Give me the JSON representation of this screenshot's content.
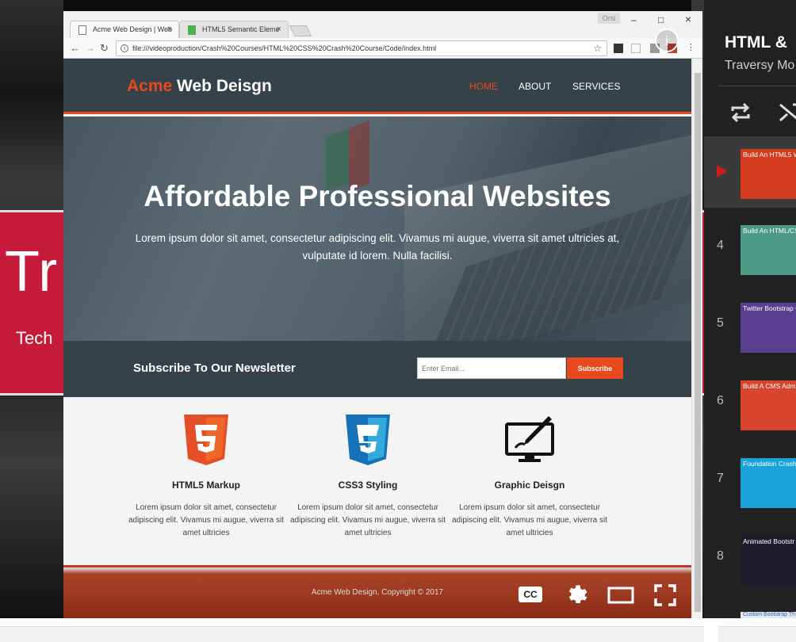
{
  "browser": {
    "tabs": [
      {
        "label": "Acme Web Design | Web",
        "close": "×"
      },
      {
        "label": "HTML5 Semantic Eleme",
        "close": "×"
      }
    ],
    "window_controls": {
      "minimize": "–",
      "maximize": "□",
      "close": "×"
    },
    "profile_badge": "Orsi",
    "url": "file:///videoproduction/Crash%20Courses/HTML%20CSS%20Crash%20Course/Code/index.html",
    "nav": {
      "back": "←",
      "forward": "→",
      "reload": "↻"
    },
    "bookmark": "☆"
  },
  "info_button": "i",
  "background_slide": {
    "big_text": "Tr",
    "sub_text": "Tech",
    "color": "#c51a3a"
  },
  "site": {
    "logo": {
      "highlight": "Acme",
      "rest": " Web Deisgn"
    },
    "nav": [
      {
        "label": "HOME",
        "active": true
      },
      {
        "label": "ABOUT",
        "active": false
      },
      {
        "label": "SERVICES",
        "active": false
      }
    ],
    "showcase": {
      "title": "Affordable Professional Websites",
      "text": "Lorem ipsum dolor sit amet, consectetur adipiscing elit. Vivamus mi augue, viverra sit amet ultricies at, vulputate id lorem. Nulla facilisi."
    },
    "newsletter": {
      "title": "Subscribe To Our Newsletter",
      "placeholder": "Enter Email...",
      "button": "Subscribe"
    },
    "boxes": [
      {
        "icon": "html5-icon",
        "title": "HTML5 Markup",
        "text": "Lorem ipsum dolor sit amet, consectetur adipiscing elit. Vivamus mi augue, viverra sit amet ultricies"
      },
      {
        "icon": "css3-icon",
        "title": "CSS3 Styling",
        "text": "Lorem ipsum dolor sit amet, consectetur adipiscing elit. Vivamus mi augue, viverra sit amet ultricies"
      },
      {
        "icon": "graphic-design-icon",
        "title": "Graphic Deisgn",
        "text": "Lorem ipsum dolor sit amet, consectetur adipiscing elit. Vivamus mi augue, viverra sit amet ultricies"
      }
    ],
    "footer": "Acme Web Design, Copyright © 2017",
    "colors": {
      "dark": "#35424a",
      "accent": "#e8491d"
    }
  },
  "player_controls": {
    "cc_label": "CC",
    "icons": [
      "settings-icon",
      "theater-mode-icon",
      "fullscreen-icon"
    ]
  },
  "playlist": {
    "title": "HTML &",
    "channel": "Traversy Mo",
    "icons": [
      "loop-icon",
      "shuffle-icon"
    ],
    "items": [
      {
        "index": "",
        "active": true,
        "thumb_caption": "Build An HTML5 W",
        "thumb_color": "#d33b1e"
      },
      {
        "index": "4",
        "active": false,
        "thumb_caption": "Build An HTML/CS",
        "thumb_color": "#4d9a86"
      },
      {
        "index": "5",
        "active": false,
        "thumb_caption": "Twitter Bootstrap C",
        "thumb_color": "#5a3e8f"
      },
      {
        "index": "6",
        "active": false,
        "thumb_caption": "Build A CMS Adm",
        "thumb_color": "#d8452f"
      },
      {
        "index": "7",
        "active": false,
        "thumb_caption": "Foundation Crash Course",
        "thumb_color": "#1aa3d9"
      },
      {
        "index": "8",
        "active": false,
        "thumb_caption": "Animated Bootstr",
        "thumb_color": "#1c1c2b"
      },
      {
        "index": "",
        "active": false,
        "thumb_caption": "Custom Bootstrap Th",
        "thumb_color": "#e8e8e8"
      }
    ]
  }
}
